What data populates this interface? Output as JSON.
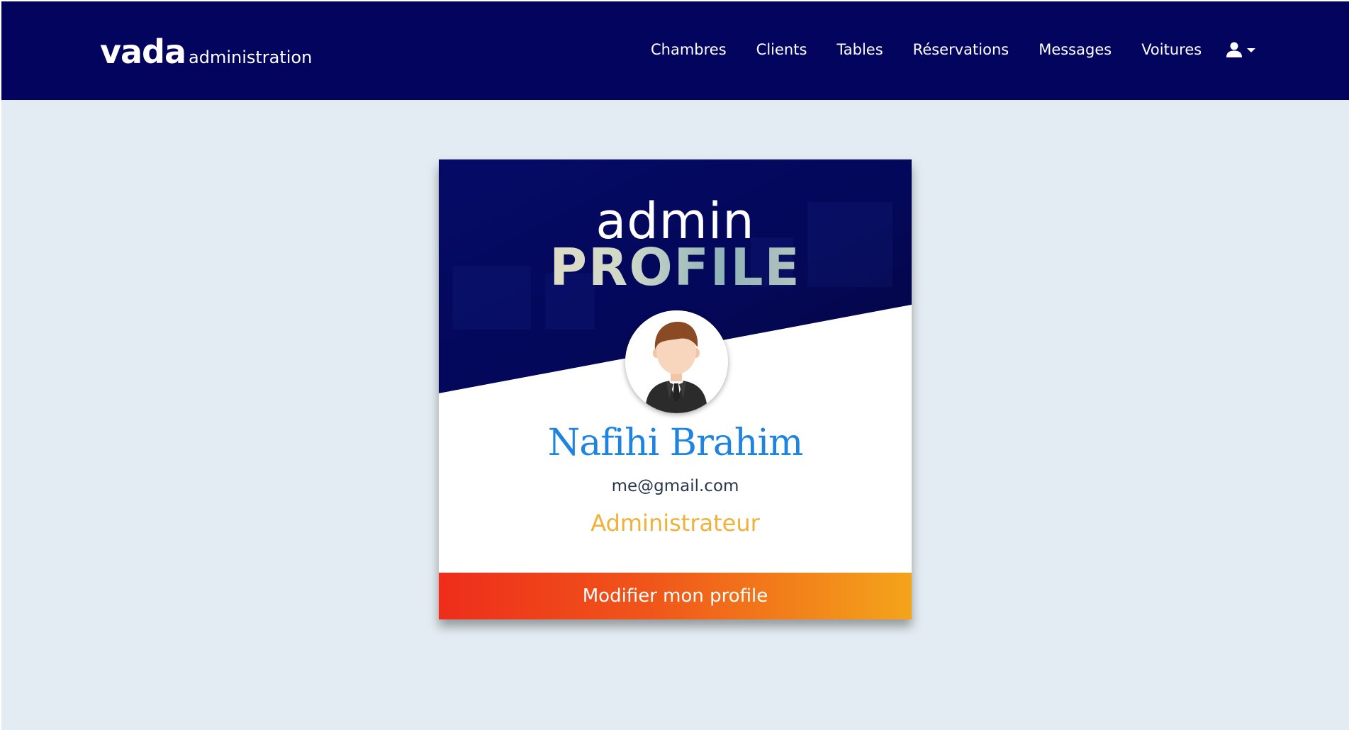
{
  "brand": {
    "main": "vada",
    "sub": "administration"
  },
  "nav": {
    "links": [
      "Chambres",
      "Clients",
      "Tables",
      "Réservations",
      "Messages",
      "Voitures"
    ],
    "user_icon": "user-icon",
    "dropdown_icon": "caret-down-icon"
  },
  "card": {
    "banner_line1": "admin",
    "banner_line2": "PROFILE",
    "avatar_icon": "businessman-avatar",
    "name": "Nafihi Brahim",
    "email": "me@gmail.com",
    "role": "Administrateur",
    "button_label": "Modifier mon profile"
  },
  "colors": {
    "navbar": "#03045e",
    "page_background": "#e3ecf2",
    "name": "#1f84e0",
    "role": "#f0b13a",
    "button_gradient_start": "#ee2d1b",
    "button_gradient_end": "#f4a41b"
  }
}
